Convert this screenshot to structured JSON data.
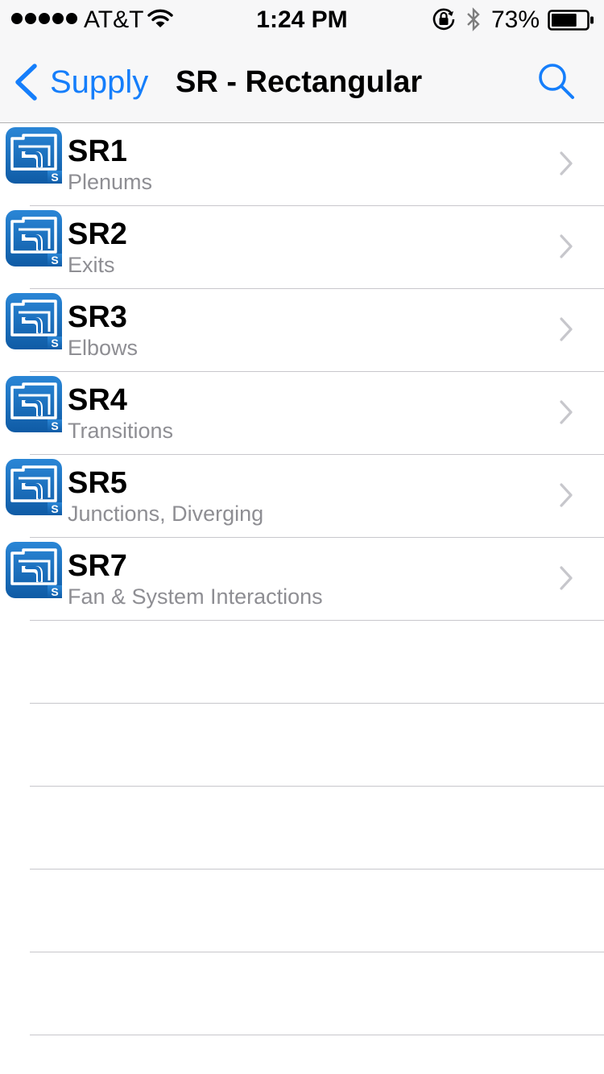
{
  "status_bar": {
    "carrier": "AT&T",
    "time": "1:24 PM",
    "battery_percent": "73%",
    "battery_level": 0.73,
    "signal_dots": 5,
    "icons": [
      "wifi-icon",
      "rotation-lock-icon",
      "bluetooth-icon",
      "battery-icon"
    ]
  },
  "nav": {
    "back_label": "Supply",
    "title": "SR - Rectangular",
    "search_icon": "search-icon",
    "back_icon": "chevron-left-icon"
  },
  "colors": {
    "accent": "#157efb",
    "icon_blue": "#1a6fbf",
    "subtitle_gray": "#8e8e93",
    "separator": "#c8c7cc"
  },
  "list": {
    "items": [
      {
        "code": "SR1",
        "name": "Plenums",
        "icon": "duct-fitting-app-icon",
        "badge": "S"
      },
      {
        "code": "SR2",
        "name": "Exits",
        "icon": "duct-fitting-app-icon",
        "badge": "S"
      },
      {
        "code": "SR3",
        "name": "Elbows",
        "icon": "duct-fitting-app-icon",
        "badge": "S"
      },
      {
        "code": "SR4",
        "name": "Transitions",
        "icon": "duct-fitting-app-icon",
        "badge": "S"
      },
      {
        "code": "SR5",
        "name": "Junctions, Diverging",
        "icon": "duct-fitting-app-icon",
        "badge": "S"
      },
      {
        "code": "SR7",
        "name": "Fan & System Interactions",
        "icon": "duct-fitting-app-icon",
        "badge": "S"
      }
    ],
    "empty_rows": 5
  }
}
